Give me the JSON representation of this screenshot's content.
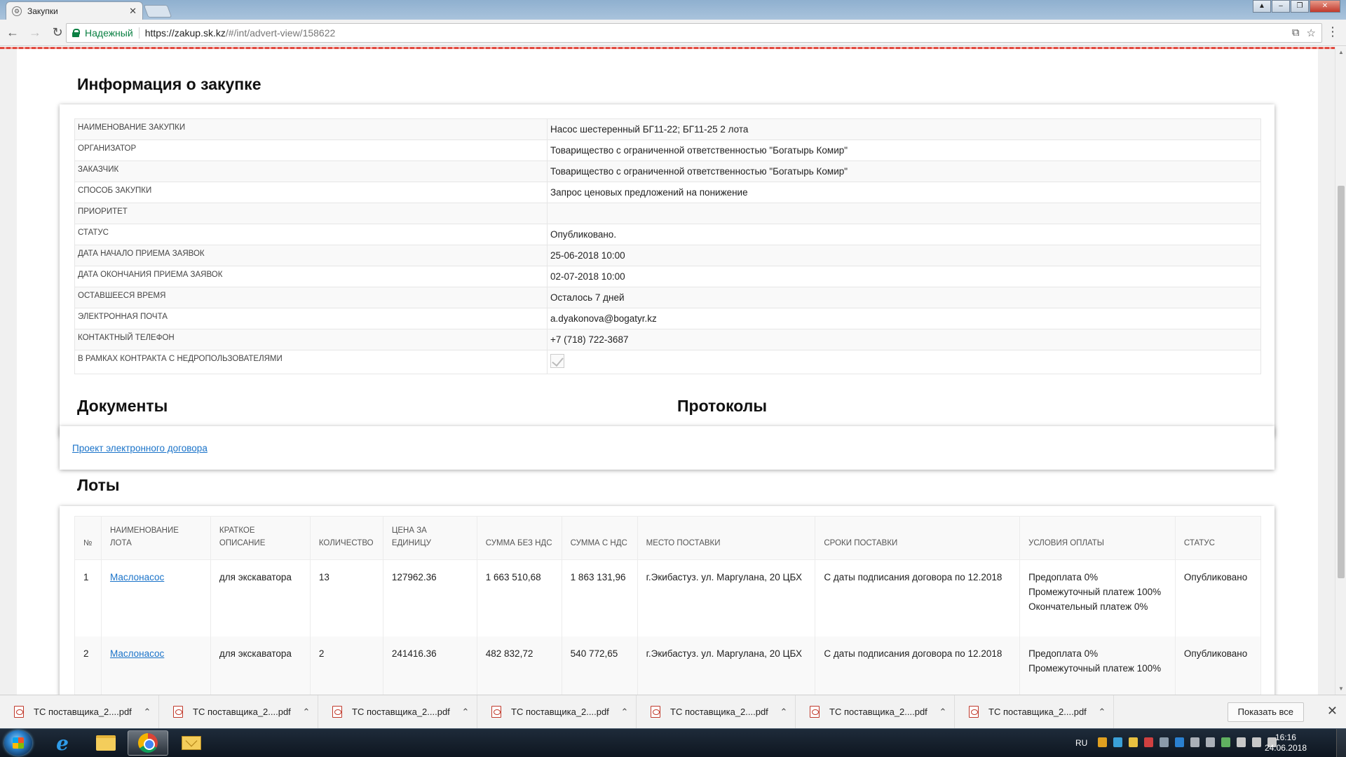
{
  "browser": {
    "tab_title": "Закупки",
    "secure_label": "Надежный",
    "url_host": "https://zakup.sk.kz",
    "url_path": "/#/int/advert-view/158622"
  },
  "info": {
    "heading": "Информация о закупке",
    "rows": [
      {
        "label": "Наименование закупки",
        "value": "Насос шестеренный БГ11-22; БГ11-25 2 лота"
      },
      {
        "label": "Организатор",
        "value": "Товарищество с ограниченной ответственностью \"Богатырь Комир\""
      },
      {
        "label": "Заказчик",
        "value": "Товарищество с ограниченной ответственностью \"Богатырь Комир\""
      },
      {
        "label": "Способ закупки",
        "value": "Запрос ценовых предложений на понижение"
      },
      {
        "label": "Приоритет",
        "value": ""
      },
      {
        "label": "Статус",
        "value": "Опубликовано."
      },
      {
        "label": "Дата начало приема заявок",
        "value": "25-06-2018 10:00"
      },
      {
        "label": "Дата окончания приема заявок",
        "value": "02-07-2018 10:00"
      },
      {
        "label": "Оставшееся время",
        "value": "Осталось 7 дней"
      },
      {
        "label": "Электронная почта",
        "value": "a.dyakonova@bogatyr.kz"
      },
      {
        "label": "Контактный телефон",
        "value": "+7 (718) 722-3687"
      },
      {
        "label": "В рамках контракта с недропользователями",
        "value": ""
      }
    ]
  },
  "documents": {
    "heading": "Документы",
    "link": "Проект электронного договора"
  },
  "protocols": {
    "heading": "Протоколы"
  },
  "lots": {
    "heading": "Лоты",
    "columns": [
      "№",
      "Наименование лота",
      "Краткое описание",
      "Количество",
      "Цена за единицу",
      "Сумма без НДС",
      "Сумма с НДС",
      "Место поставки",
      "Сроки поставки",
      "Условия оплаты",
      "Статус"
    ],
    "rows": [
      {
        "num": "1",
        "name": "Маслонасос",
        "desc": "для экскаватора",
        "qty": "13",
        "price": "127962.36",
        "sum_no_vat": "1 663 510,68",
        "sum_vat": "1 863 131,96",
        "place": "г.Экибастуз. ул. Маргулана, 20 ЦБХ",
        "terms": "С даты подписания договора по 12.2018",
        "pay1": "Предоплата 0%",
        "pay2": "Промежуточный платеж 100%",
        "pay3": "Окончательный платеж 0%",
        "status": "Опубликовано"
      },
      {
        "num": "2",
        "name": "Маслонасос",
        "desc": "для экскаватора",
        "qty": "2",
        "price": "241416.36",
        "sum_no_vat": "482 832,72",
        "sum_vat": "540 772,65",
        "place": "г.Экибастуз. ул. Маргулана, 20 ЦБХ",
        "terms": "С даты подписания договора по 12.2018",
        "pay1": "Предоплата 0%",
        "pay2": "Промежуточный платеж 100%",
        "pay3": "",
        "status": "Опубликовано"
      }
    ]
  },
  "downloads": {
    "items": [
      "ТС поставщика_2....pdf",
      "ТС поставщика_2....pdf",
      "ТС поставщика_2....pdf",
      "ТС поставщика_2....pdf",
      "ТС поставщика_2....pdf",
      "ТС поставщика_2....pdf",
      "ТС поставщика_2....pdf"
    ],
    "show_all": "Показать все"
  },
  "taskbar": {
    "lang": "RU",
    "time": "16:16",
    "date": "24.06.2018"
  }
}
